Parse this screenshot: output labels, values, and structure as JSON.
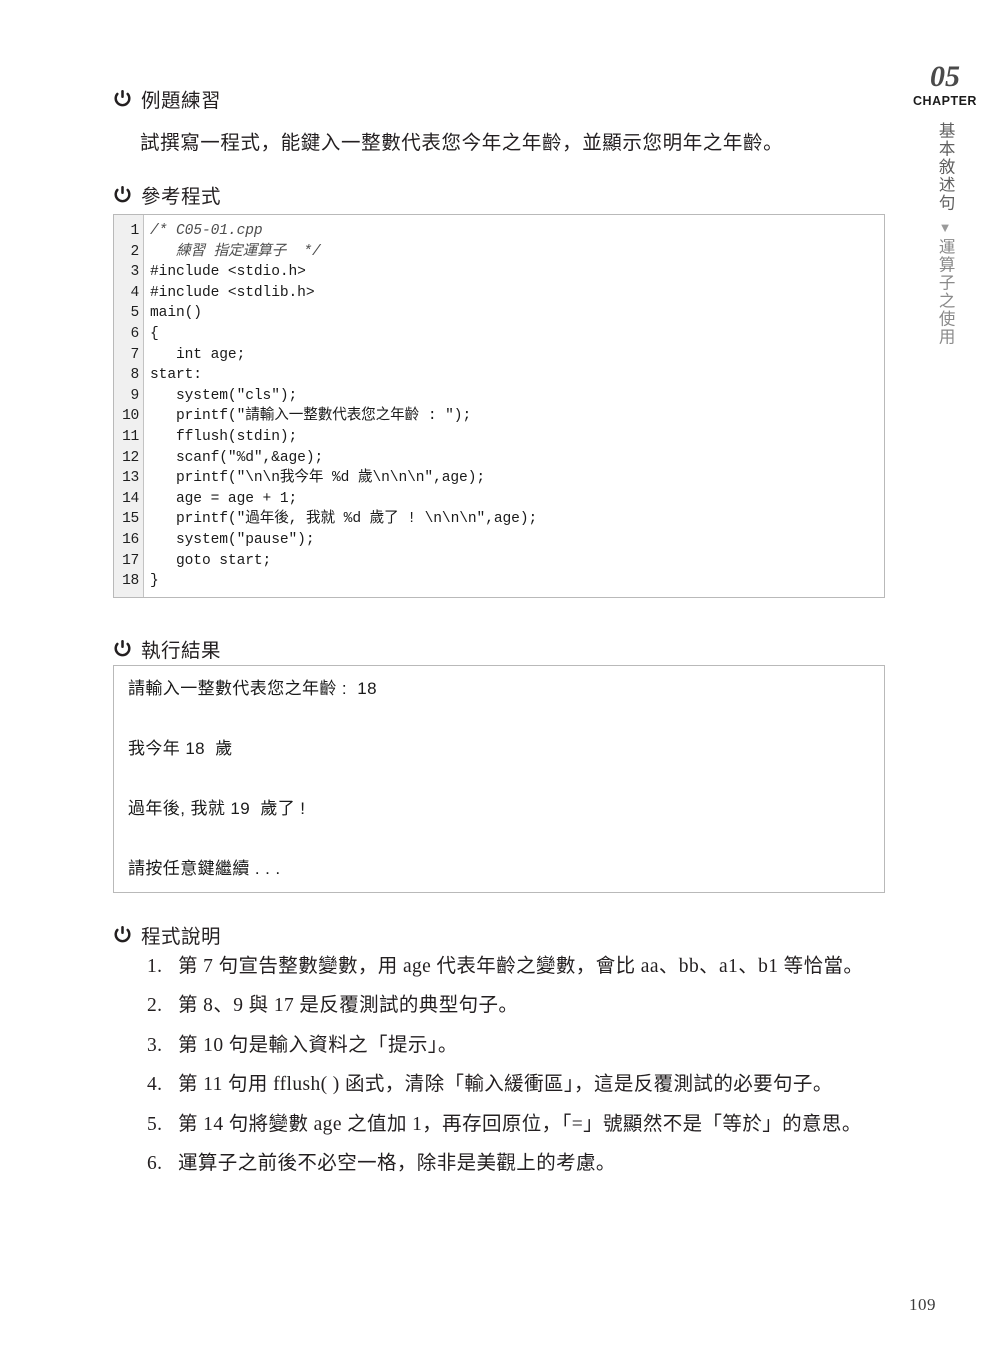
{
  "chapter_rail": {
    "number": "05",
    "word": "CHAPTER",
    "title_vertical": "基本敘述句",
    "arrow_icon": "triangle-down-icon",
    "subtitle_vertical": "運算子之使用"
  },
  "sections": {
    "example": {
      "icon": "power-icon",
      "heading": "例題練習"
    },
    "reference": {
      "icon": "power-icon",
      "heading": "參考程式"
    },
    "result": {
      "icon": "power-icon",
      "heading": "執行結果"
    },
    "explanation": {
      "icon": "power-icon",
      "heading": "程式說明"
    }
  },
  "intro_paragraph": "試撰寫一程式，能鍵入一整數代表您今年之年齡，並顯示您明年之年齡。",
  "code_listing": {
    "language": "cpp",
    "lines": [
      {
        "n": "1",
        "text": "/* C05-01.cpp",
        "style": "comment"
      },
      {
        "n": "2",
        "text": "   練習 指定運算子  */",
        "style": "comment"
      },
      {
        "n": "3",
        "text": "#include <stdio.h>",
        "style": "plain"
      },
      {
        "n": "4",
        "text": "#include <stdlib.h>",
        "style": "plain"
      },
      {
        "n": "5",
        "text": "main()",
        "style": "plain"
      },
      {
        "n": "6",
        "text": "{",
        "style": "plain"
      },
      {
        "n": "7",
        "text": "   int age;",
        "style": "plain"
      },
      {
        "n": "8",
        "text": "start:",
        "style": "plain"
      },
      {
        "n": "9",
        "text": "   system(\"cls\");",
        "style": "plain"
      },
      {
        "n": "10",
        "text": "   printf(\"請輸入一整數代表您之年齡 : \");",
        "style": "plain"
      },
      {
        "n": "11",
        "text": "   fflush(stdin);",
        "style": "plain"
      },
      {
        "n": "12",
        "text": "   scanf(\"%d\",&age);",
        "style": "plain"
      },
      {
        "n": "13",
        "text": "   printf(\"\\n\\n我今年 %d 歲\\n\\n\\n\",age);",
        "style": "plain"
      },
      {
        "n": "14",
        "text": "   age = age + 1;",
        "style": "plain"
      },
      {
        "n": "15",
        "text": "   printf(\"過年後, 我就 %d 歲了 ! \\n\\n\\n\",age);",
        "style": "plain"
      },
      {
        "n": "16",
        "text": "   system(\"pause\");",
        "style": "plain"
      },
      {
        "n": "17",
        "text": "   goto start;",
        "style": "plain"
      },
      {
        "n": "18",
        "text": "}",
        "style": "plain"
      }
    ]
  },
  "execution_output": {
    "lines": [
      "請輸入一整數代表您之年齡 :  18",
      "我今年 18  歲",
      "過年後, 我就 19  歲了 !",
      "請按任意鍵繼續 . . ."
    ],
    "input_value": "18",
    "next_age_value": "19"
  },
  "explanations": [
    {
      "num": "1.",
      "text": "第 7 句宣告整數變數，用 age 代表年齡之變數，會比 aa、bb、a1、b1 等恰當。"
    },
    {
      "num": "2.",
      "text": "第 8、9 與 17 是反覆測試的典型句子。"
    },
    {
      "num": "3.",
      "text": "第 10 句是輸入資料之「提示」。"
    },
    {
      "num": "4.",
      "text": "第 11 句用 fflush( ) 函式，清除「輸入緩衝區」，這是反覆測試的必要句子。"
    },
    {
      "num": "5.",
      "text": "第 14 句將變數 age 之值加 1，再存回原位，「=」號顯然不是「等於」的意思。"
    },
    {
      "num": "6.",
      "text": "運算子之前後不必空一格，除非是美觀上的考慮。"
    }
  ],
  "page_number": "109",
  "colors": {
    "text": "#231f20",
    "box_border": "#b9b9b9",
    "gutter_bg": "#f0f0f0",
    "rail_gray": "#5f5f5f"
  }
}
